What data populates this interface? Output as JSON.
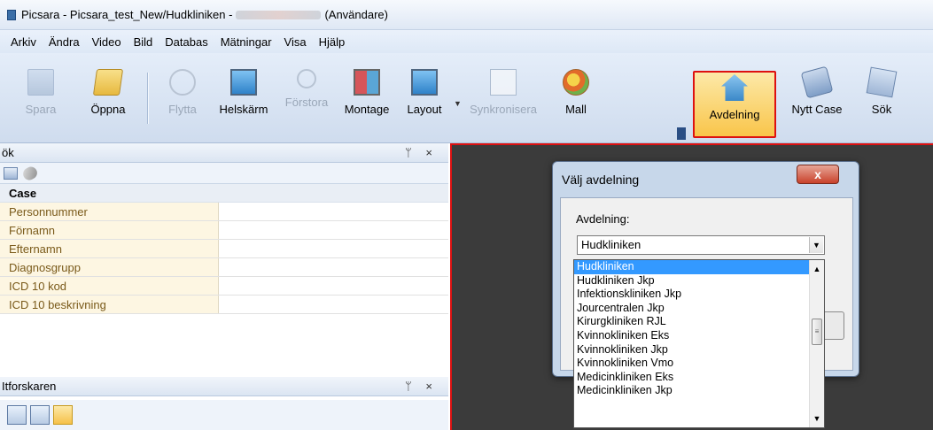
{
  "window": {
    "title_prefix": "Picsara - Picsara_test_New/Hudkliniken -",
    "title_suffix": "(Användare)"
  },
  "menu": [
    "Arkiv",
    "Ändra",
    "Video",
    "Bild",
    "Databas",
    "Mätningar",
    "Visa",
    "Hjälp"
  ],
  "toolbar": {
    "spara": "Spara",
    "oppna": "Öppna",
    "flytta": "Flytta",
    "helskarm": "Helskärm",
    "forstora": "Förstora",
    "montage": "Montage",
    "layout": "Layout",
    "synkronisera": "Synkronisera",
    "mall": "Mall",
    "avdelning": "Avdelning",
    "nytt_case": "Nytt Case",
    "sok": "Sök"
  },
  "search_panel": {
    "title": "ök",
    "pin_close": "ᛘ ×",
    "category": "Case",
    "fields": [
      "Personnummer",
      "Förnamn",
      "Efternamn",
      "Diagnosgrupp",
      "ICD 10 kod",
      "ICD 10 beskrivning"
    ]
  },
  "explorer_panel": {
    "title": "Itforskaren",
    "pin_close": "ᛘ ×"
  },
  "dialog": {
    "title": "Välj avdelning",
    "close": "x",
    "field_label": "Avdelning:",
    "selected_value": "Hudkliniken",
    "options": [
      "Hudkliniken",
      "Hudkliniken Jkp",
      "Infektionskliniken Jkp",
      "Jourcentralen Jkp",
      "Kirurgkliniken RJL",
      "Kvinnokliniken Eks",
      "Kvinnokliniken Jkp",
      "Kvinnokliniken Vmo",
      "Medicinkliniken Eks",
      "Medicinkliniken Jkp"
    ]
  }
}
